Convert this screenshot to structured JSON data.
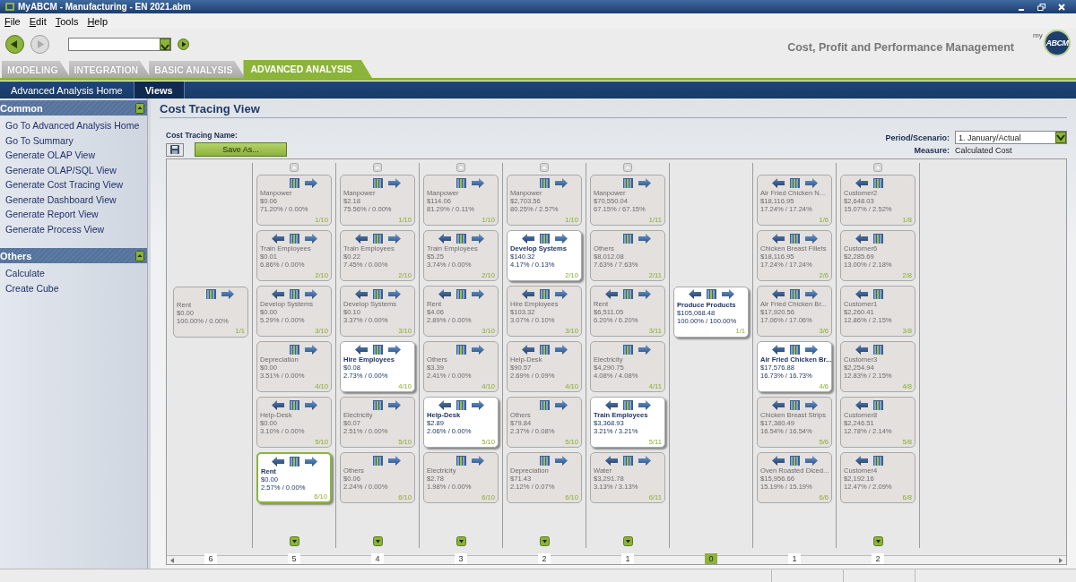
{
  "window": {
    "title": "MyABCM - Manufacturing - EN 2021.abm"
  },
  "menu": [
    "File",
    "Edit",
    "Tools",
    "Help"
  ],
  "toolbar": {
    "tagline": "Cost, Profit and Performance Management",
    "logo": {
      "prefix": "my",
      "name": "ABCM"
    }
  },
  "tabs": [
    {
      "label": "MODELING",
      "selected": false
    },
    {
      "label": "INTEGRATION",
      "selected": false
    },
    {
      "label": "BASIC ANALYSIS",
      "selected": false
    },
    {
      "label": "ADVANCED ANALYSIS",
      "selected": true
    }
  ],
  "subnav": [
    {
      "label": "Advanced Analysis Home",
      "selected": false
    },
    {
      "label": "Views",
      "selected": true
    }
  ],
  "sidebar": {
    "sections": [
      {
        "title": "Common",
        "items": [
          "Go To Advanced Analysis Home",
          "Go To Summary",
          "Generate OLAP View",
          "Generate OLAP/SQL View",
          "Generate Cost Tracing View",
          "Generate Dashboard View",
          "Generate Report View",
          "Generate Process View"
        ]
      },
      {
        "title": "Others",
        "items": [
          "Calculate",
          "Create Cube"
        ]
      }
    ]
  },
  "view": {
    "title": "Cost Tracing View",
    "name_label": "Cost Tracing Name:",
    "save_as": "Save As...",
    "period_label": "Period/Scenario:",
    "period_value": "1. January/Actual",
    "measure_label": "Measure:",
    "measure_value": "Calculated Cost"
  },
  "columns": [
    {
      "step": "6",
      "selected": false,
      "scroll_up": false,
      "scroll_down": false,
      "cards": [
        {
          "name": "Rent",
          "amount": "$0.00",
          "share": "100.00% / 0.00%",
          "index": "1/1",
          "trace_back": false,
          "trace_forward": true,
          "highlighted": false,
          "selected": false
        }
      ]
    },
    {
      "step": "5",
      "selected": false,
      "scroll_up": true,
      "scroll_down": true,
      "cards": [
        {
          "name": "Manpower",
          "amount": "$0.06",
          "share": "71.20% / 0.00%",
          "index": "1/10",
          "trace_back": false,
          "trace_forward": true,
          "highlighted": false,
          "selected": false
        },
        {
          "name": "Train Employees",
          "amount": "$0.01",
          "share": "6.86% / 0.00%",
          "index": "2/10",
          "trace_back": true,
          "trace_forward": true,
          "highlighted": false,
          "selected": false
        },
        {
          "name": "Develop Systems",
          "amount": "$0.00",
          "share": "5.29% / 0.00%",
          "index": "3/10",
          "trace_back": true,
          "trace_forward": true,
          "highlighted": false,
          "selected": false
        },
        {
          "name": "Depreciation",
          "amount": "$0.00",
          "share": "3.51% / 0.00%",
          "index": "4/10",
          "trace_back": false,
          "trace_forward": true,
          "highlighted": false,
          "selected": false
        },
        {
          "name": "Help-Desk",
          "amount": "$0.00",
          "share": "3.10% / 0.00%",
          "index": "5/10",
          "trace_back": true,
          "trace_forward": true,
          "highlighted": false,
          "selected": false
        },
        {
          "name": "Rent",
          "amount": "$0.00",
          "share": "2.57% / 0.00%",
          "index": "6/10",
          "trace_back": true,
          "trace_forward": true,
          "highlighted": true,
          "selected": true
        }
      ]
    },
    {
      "step": "4",
      "selected": false,
      "scroll_up": true,
      "scroll_down": true,
      "cards": [
        {
          "name": "Manpower",
          "amount": "$2.18",
          "share": "75.56% / 0.00%",
          "index": "1/10",
          "trace_back": false,
          "trace_forward": true,
          "highlighted": false,
          "selected": false
        },
        {
          "name": "Train Employees",
          "amount": "$0.22",
          "share": "7.45% / 0.00%",
          "index": "2/10",
          "trace_back": true,
          "trace_forward": true,
          "highlighted": false,
          "selected": false
        },
        {
          "name": "Develop Systems",
          "amount": "$0.10",
          "share": "3.37% / 0.00%",
          "index": "3/10",
          "trace_back": true,
          "trace_forward": true,
          "highlighted": false,
          "selected": false
        },
        {
          "name": "Hire Employees",
          "amount": "$0.08",
          "share": "2.73% / 0.00%",
          "index": "4/10",
          "trace_back": true,
          "trace_forward": true,
          "highlighted": true,
          "selected": false
        },
        {
          "name": "Electricity",
          "amount": "$0.07",
          "share": "2.51% / 0.00%",
          "index": "5/10",
          "trace_back": false,
          "trace_forward": true,
          "highlighted": false,
          "selected": false
        },
        {
          "name": "Others",
          "amount": "$0.06",
          "share": "2.24% / 0.00%",
          "index": "6/10",
          "trace_back": false,
          "trace_forward": true,
          "highlighted": false,
          "selected": false
        }
      ]
    },
    {
      "step": "3",
      "selected": false,
      "scroll_up": true,
      "scroll_down": true,
      "cards": [
        {
          "name": "Manpower",
          "amount": "$114.06",
          "share": "81.29% / 0.11%",
          "index": "1/10",
          "trace_back": false,
          "trace_forward": true,
          "highlighted": false,
          "selected": false
        },
        {
          "name": "Train Employees",
          "amount": "$5.25",
          "share": "3.74% / 0.00%",
          "index": "2/10",
          "trace_back": true,
          "trace_forward": true,
          "highlighted": false,
          "selected": false
        },
        {
          "name": "Rent",
          "amount": "$4.06",
          "share": "2.89% / 0.00%",
          "index": "3/10",
          "trace_back": true,
          "trace_forward": true,
          "highlighted": false,
          "selected": false
        },
        {
          "name": "Others",
          "amount": "$3.39",
          "share": "2.41% / 0.00%",
          "index": "4/10",
          "trace_back": false,
          "trace_forward": true,
          "highlighted": false,
          "selected": false
        },
        {
          "name": "Help-Desk",
          "amount": "$2.89",
          "share": "2.06% / 0.00%",
          "index": "5/10",
          "trace_back": true,
          "trace_forward": true,
          "highlighted": true,
          "selected": false
        },
        {
          "name": "Electricity",
          "amount": "$2.78",
          "share": "1.98% / 0.00%",
          "index": "6/10",
          "trace_back": false,
          "trace_forward": true,
          "highlighted": false,
          "selected": false
        }
      ]
    },
    {
      "step": "2",
      "selected": false,
      "scroll_up": true,
      "scroll_down": true,
      "cards": [
        {
          "name": "Manpower",
          "amount": "$2,703.56",
          "share": "80.25% / 2.57%",
          "index": "1/10",
          "trace_back": false,
          "trace_forward": true,
          "highlighted": false,
          "selected": false
        },
        {
          "name": "Develop Systems",
          "amount": "$140.32",
          "share": "4.17% / 0.13%",
          "index": "2/10",
          "trace_back": true,
          "trace_forward": true,
          "highlighted": true,
          "selected": false
        },
        {
          "name": "Hire Employees",
          "amount": "$103.32",
          "share": "3.07% / 0.10%",
          "index": "3/10",
          "trace_back": true,
          "trace_forward": true,
          "highlighted": false,
          "selected": false
        },
        {
          "name": "Help-Desk",
          "amount": "$90.57",
          "share": "2.69% / 0.09%",
          "index": "4/10",
          "trace_back": true,
          "trace_forward": true,
          "highlighted": false,
          "selected": false
        },
        {
          "name": "Others",
          "amount": "$79.84",
          "share": "2.37% / 0.08%",
          "index": "5/10",
          "trace_back": false,
          "trace_forward": true,
          "highlighted": false,
          "selected": false
        },
        {
          "name": "Depreciation",
          "amount": "$71.43",
          "share": "2.12% / 0.07%",
          "index": "6/10",
          "trace_back": false,
          "trace_forward": true,
          "highlighted": false,
          "selected": false
        }
      ]
    },
    {
      "step": "1",
      "selected": false,
      "scroll_up": true,
      "scroll_down": true,
      "cards": [
        {
          "name": "Manpower",
          "amount": "$70,550.04",
          "share": "67.15% / 67.15%",
          "index": "1/11",
          "trace_back": false,
          "trace_forward": true,
          "highlighted": false,
          "selected": false
        },
        {
          "name": "Others",
          "amount": "$8,012.08",
          "share": "7.63% / 7.63%",
          "index": "2/11",
          "trace_back": false,
          "trace_forward": true,
          "highlighted": false,
          "selected": false
        },
        {
          "name": "Rent",
          "amount": "$6,511.05",
          "share": "6.20% / 6.20%",
          "index": "3/11",
          "trace_back": true,
          "trace_forward": true,
          "highlighted": false,
          "selected": false
        },
        {
          "name": "Electricity",
          "amount": "$4,290.75",
          "share": "4.08% / 4.08%",
          "index": "4/11",
          "trace_back": false,
          "trace_forward": true,
          "highlighted": false,
          "selected": false
        },
        {
          "name": "Train Employees",
          "amount": "$3,368.93",
          "share": "3.21% / 3.21%",
          "index": "5/11",
          "trace_back": true,
          "trace_forward": true,
          "highlighted": true,
          "selected": false
        },
        {
          "name": "Water",
          "amount": "$3,291.78",
          "share": "3.13% / 3.13%",
          "index": "6/11",
          "trace_back": true,
          "trace_forward": true,
          "highlighted": false,
          "selected": false
        }
      ]
    },
    {
      "step": "0",
      "selected": true,
      "scroll_up": false,
      "scroll_down": false,
      "cards": [
        {
          "name": "Produce Products",
          "amount": "$105,068.48",
          "share": "100.00% / 100.00%",
          "index": "1/1",
          "trace_back": true,
          "trace_forward": true,
          "highlighted": true,
          "selected": false
        }
      ]
    },
    {
      "step": "1",
      "selected": false,
      "scroll_up": false,
      "scroll_down": false,
      "cards": [
        {
          "name": "Air Fried Chicken N...",
          "amount": "$18,116.95",
          "share": "17.24% / 17.24%",
          "index": "1/6",
          "trace_back": true,
          "trace_forward": true,
          "highlighted": false,
          "selected": false
        },
        {
          "name": "Chicken Breast Fillets",
          "amount": "$18,116.95",
          "share": "17.24% / 17.24%",
          "index": "2/6",
          "trace_back": true,
          "trace_forward": true,
          "highlighted": false,
          "selected": false
        },
        {
          "name": "Air Fried Chicken Br...",
          "amount": "$17,920.56",
          "share": "17.06% / 17.06%",
          "index": "3/6",
          "trace_back": true,
          "trace_forward": true,
          "highlighted": false,
          "selected": false
        },
        {
          "name": "Air Fried Chicken Br...",
          "amount": "$17,576.88",
          "share": "16.73% / 16.73%",
          "index": "4/6",
          "trace_back": true,
          "trace_forward": true,
          "highlighted": true,
          "selected": false
        },
        {
          "name": "Chicken Breast Strips",
          "amount": "$17,380.49",
          "share": "16.54% / 16.54%",
          "index": "5/6",
          "trace_back": true,
          "trace_forward": true,
          "highlighted": false,
          "selected": false
        },
        {
          "name": "Oven Roasted Diced...",
          "amount": "$15,956.66",
          "share": "15.19% / 15.19%",
          "index": "6/6",
          "trace_back": true,
          "trace_forward": true,
          "highlighted": false,
          "selected": false
        }
      ]
    },
    {
      "step": "2",
      "selected": false,
      "scroll_up": true,
      "scroll_down": true,
      "cards": [
        {
          "name": "Customer2",
          "amount": "$2,648.03",
          "share": "15.07% / 2.52%",
          "index": "1/8",
          "trace_back": true,
          "trace_forward": false,
          "highlighted": false,
          "selected": false
        },
        {
          "name": "Customer6",
          "amount": "$2,285.69",
          "share": "13.00% / 2.18%",
          "index": "2/8",
          "trace_back": true,
          "trace_forward": false,
          "highlighted": false,
          "selected": false
        },
        {
          "name": "Customer1",
          "amount": "$2,260.41",
          "share": "12.86% / 2.15%",
          "index": "3/8",
          "trace_back": true,
          "trace_forward": false,
          "highlighted": false,
          "selected": false
        },
        {
          "name": "Customer3",
          "amount": "$2,254.94",
          "share": "12.83% / 2.15%",
          "index": "4/8",
          "trace_back": true,
          "trace_forward": false,
          "highlighted": false,
          "selected": false
        },
        {
          "name": "Customer8",
          "amount": "$2,246.51",
          "share": "12.78% / 2.14%",
          "index": "5/8",
          "trace_back": true,
          "trace_forward": false,
          "highlighted": false,
          "selected": false
        },
        {
          "name": "Customer4",
          "amount": "$2,192.16",
          "share": "12.47% / 2.09%",
          "index": "6/8",
          "trace_back": true,
          "trace_forward": false,
          "highlighted": false,
          "selected": false
        }
      ]
    }
  ]
}
